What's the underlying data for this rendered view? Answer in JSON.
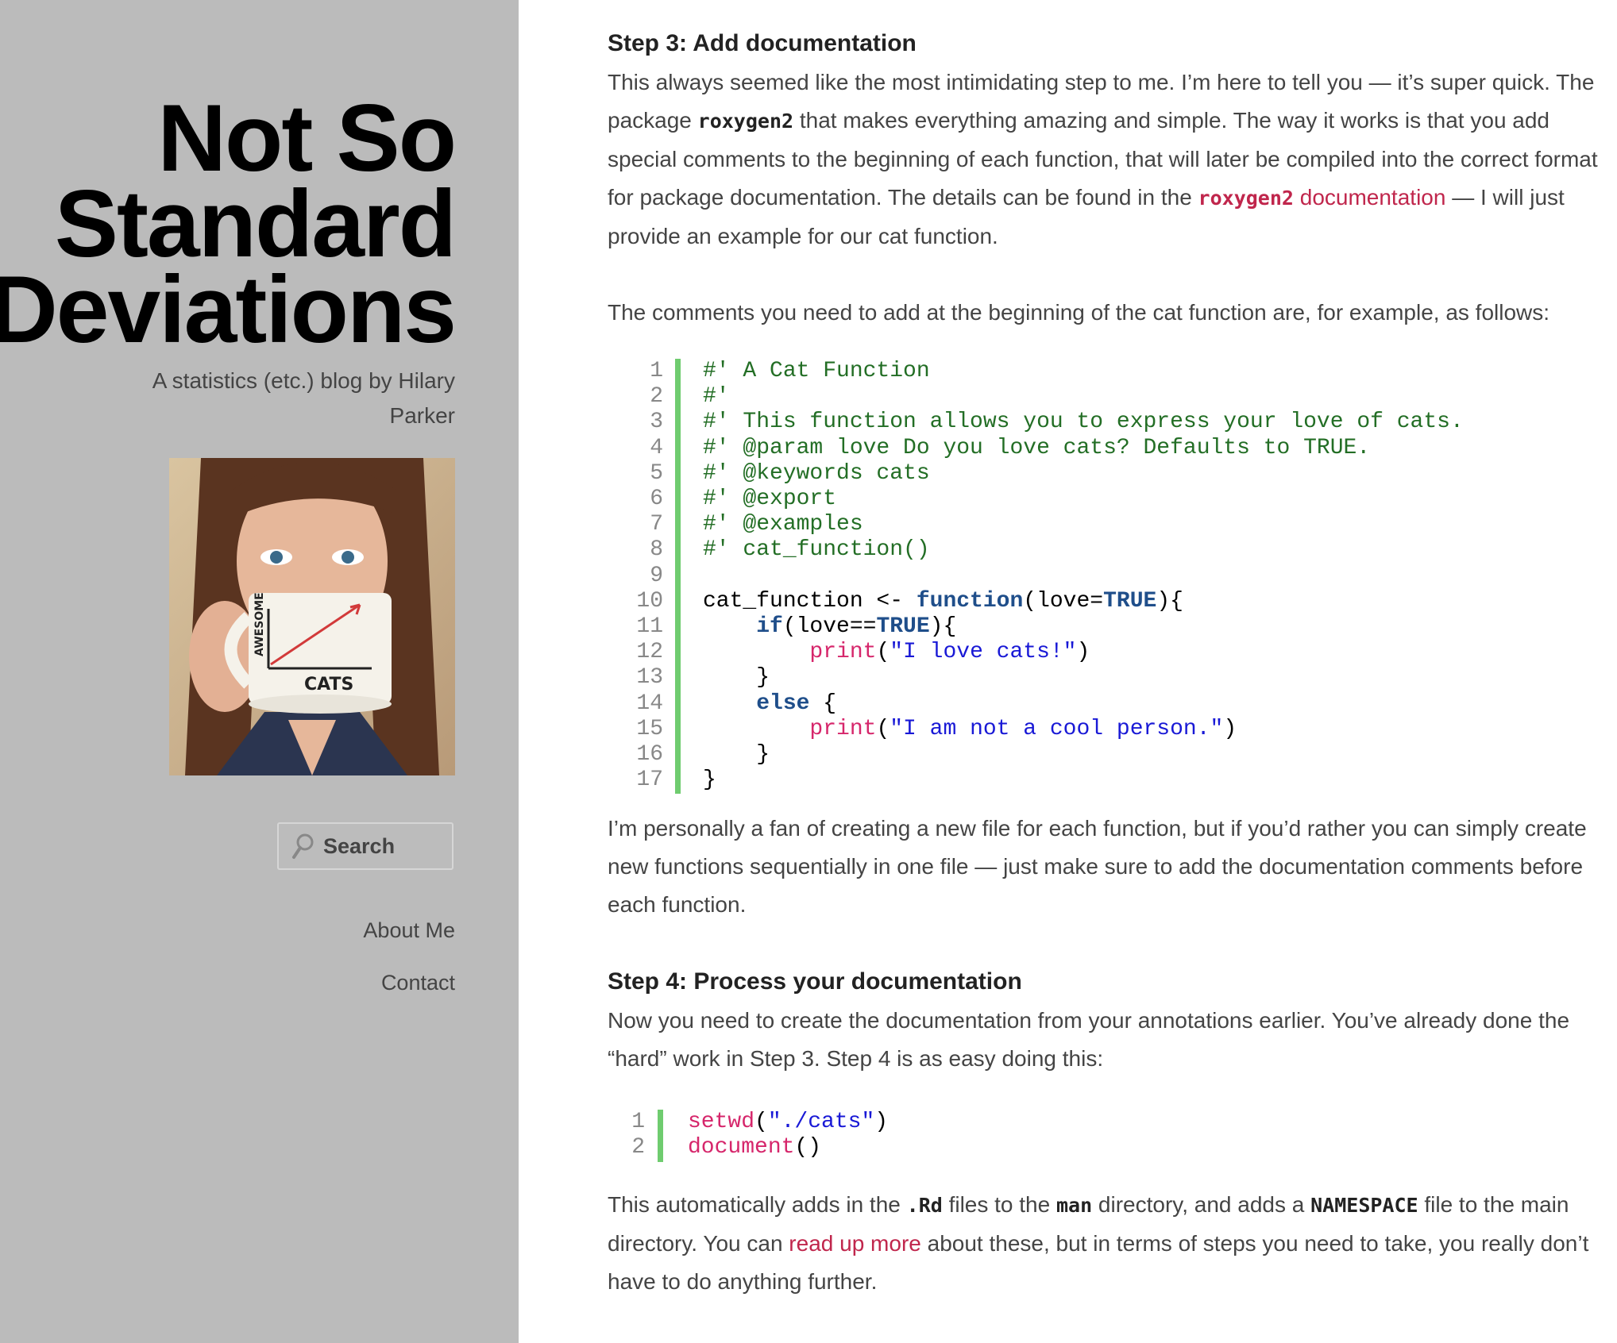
{
  "sidebar": {
    "title_lines": [
      "Not So",
      "Standard",
      "Deviations"
    ],
    "tagline": "A statistics (etc.) blog by Hilary Parker",
    "avatar_alt": "Woman holding an AWESOME vs CATS mug",
    "mug_labels": {
      "y": "AWESOME",
      "x": "CATS"
    },
    "search_placeholder": "Search",
    "nav": [
      "About Me",
      "Contact"
    ]
  },
  "article": {
    "step3_heading": "Step 3: Add documentation",
    "step3_p1": {
      "a": "This always seemed like the most intimidating step to me. I’m here to tell you — it’s super quick. The package ",
      "code": "roxygen2",
      "b": " that makes everything amazing and simple. The way it works is that you add special comments to the beginning of each function, that will later be compiled into the correct format for package documentation. The details can be found in the ",
      "link_code": "roxygen2",
      "link_text": " documentation",
      "c": " — I will just provide an example for our cat function."
    },
    "step3_p2": "The comments you need to add at the beginning of the cat function are, for example, as follows:",
    "code1_lines": [
      "#' A Cat Function",
      "#'",
      "#' This function allows you to express your love of cats.",
      "#' @param love Do you love cats? Defaults to TRUE.",
      "#' @keywords cats",
      "#' @export",
      "#' @examples",
      "#' cat_function()",
      "",
      "cat_function <- function(love=TRUE){",
      "    if(love==TRUE){",
      "        print(\"I love cats!\")",
      "    }",
      "    else {",
      "        print(\"I am not a cool person.\")",
      "    }",
      "}"
    ],
    "step3_p3": "I’m personally a fan of creating a new file for each function, but if you’d rather you can simply create new functions sequentially in one file — just make sure to add the documentation comments before each function.",
    "step4_heading": "Step 4: Process your documentation",
    "step4_p1": "Now you need to create the documentation from your annotations earlier. You’ve already done the “hard” work in Step 3. Step 4 is as easy doing this:",
    "code2_lines": [
      "setwd(\"./cats\")",
      "document()"
    ],
    "step4_p2": {
      "a": "This automatically adds in the ",
      "code1": ".Rd",
      "b": " files to the ",
      "code2": "man",
      "c": " directory, and adds a ",
      "code3": "NAMESPACE",
      "d": " file to the main directory. You can ",
      "link": "read up more",
      "e": " about these, but in terms of steps you need to take, you really don’t have to do anything further."
    }
  },
  "colors": {
    "sidebar_bg": "#bbbbbb",
    "link": "#c0264c",
    "code_bar": "#6fcc6f",
    "comment": "#236e25",
    "keyword": "#1f4e8a",
    "function": "#d6266b",
    "string": "#1919d6"
  }
}
